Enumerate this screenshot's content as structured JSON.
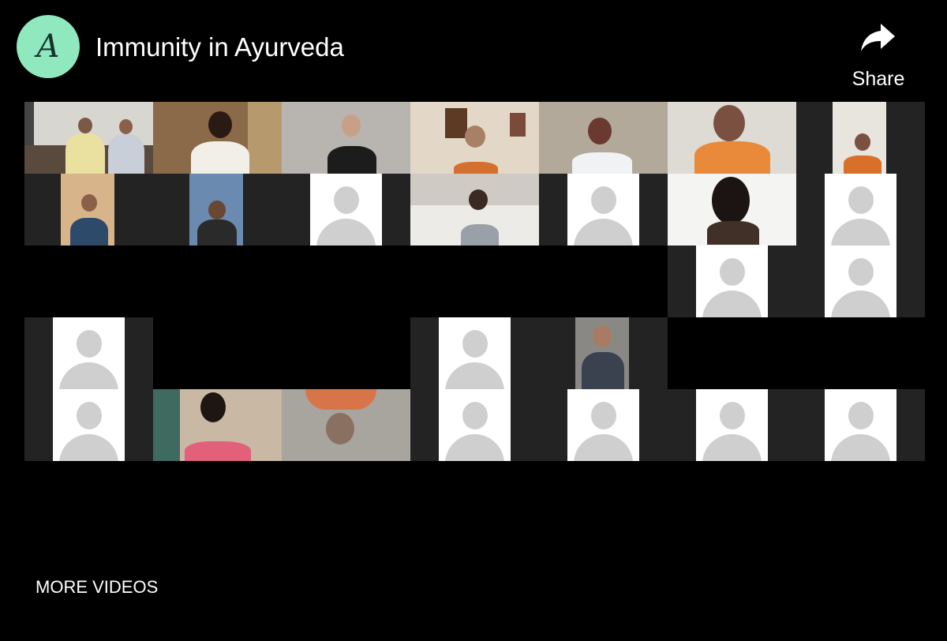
{
  "header": {
    "channel_initial": "A",
    "title": "Immunity in Ayurveda",
    "share_label": "Share"
  },
  "icons": {
    "share": "share-arrow-icon",
    "participant_placeholder": "user-silhouette-icon"
  },
  "footer": {
    "more_videos_label": "MORE VIDEOS"
  },
  "colors": {
    "background": "#000000",
    "channel_avatar": "#8fe8be",
    "tile_background": "#232323",
    "placeholder_background": "#ffffff",
    "placeholder_figure": "#cfcfcf"
  }
}
